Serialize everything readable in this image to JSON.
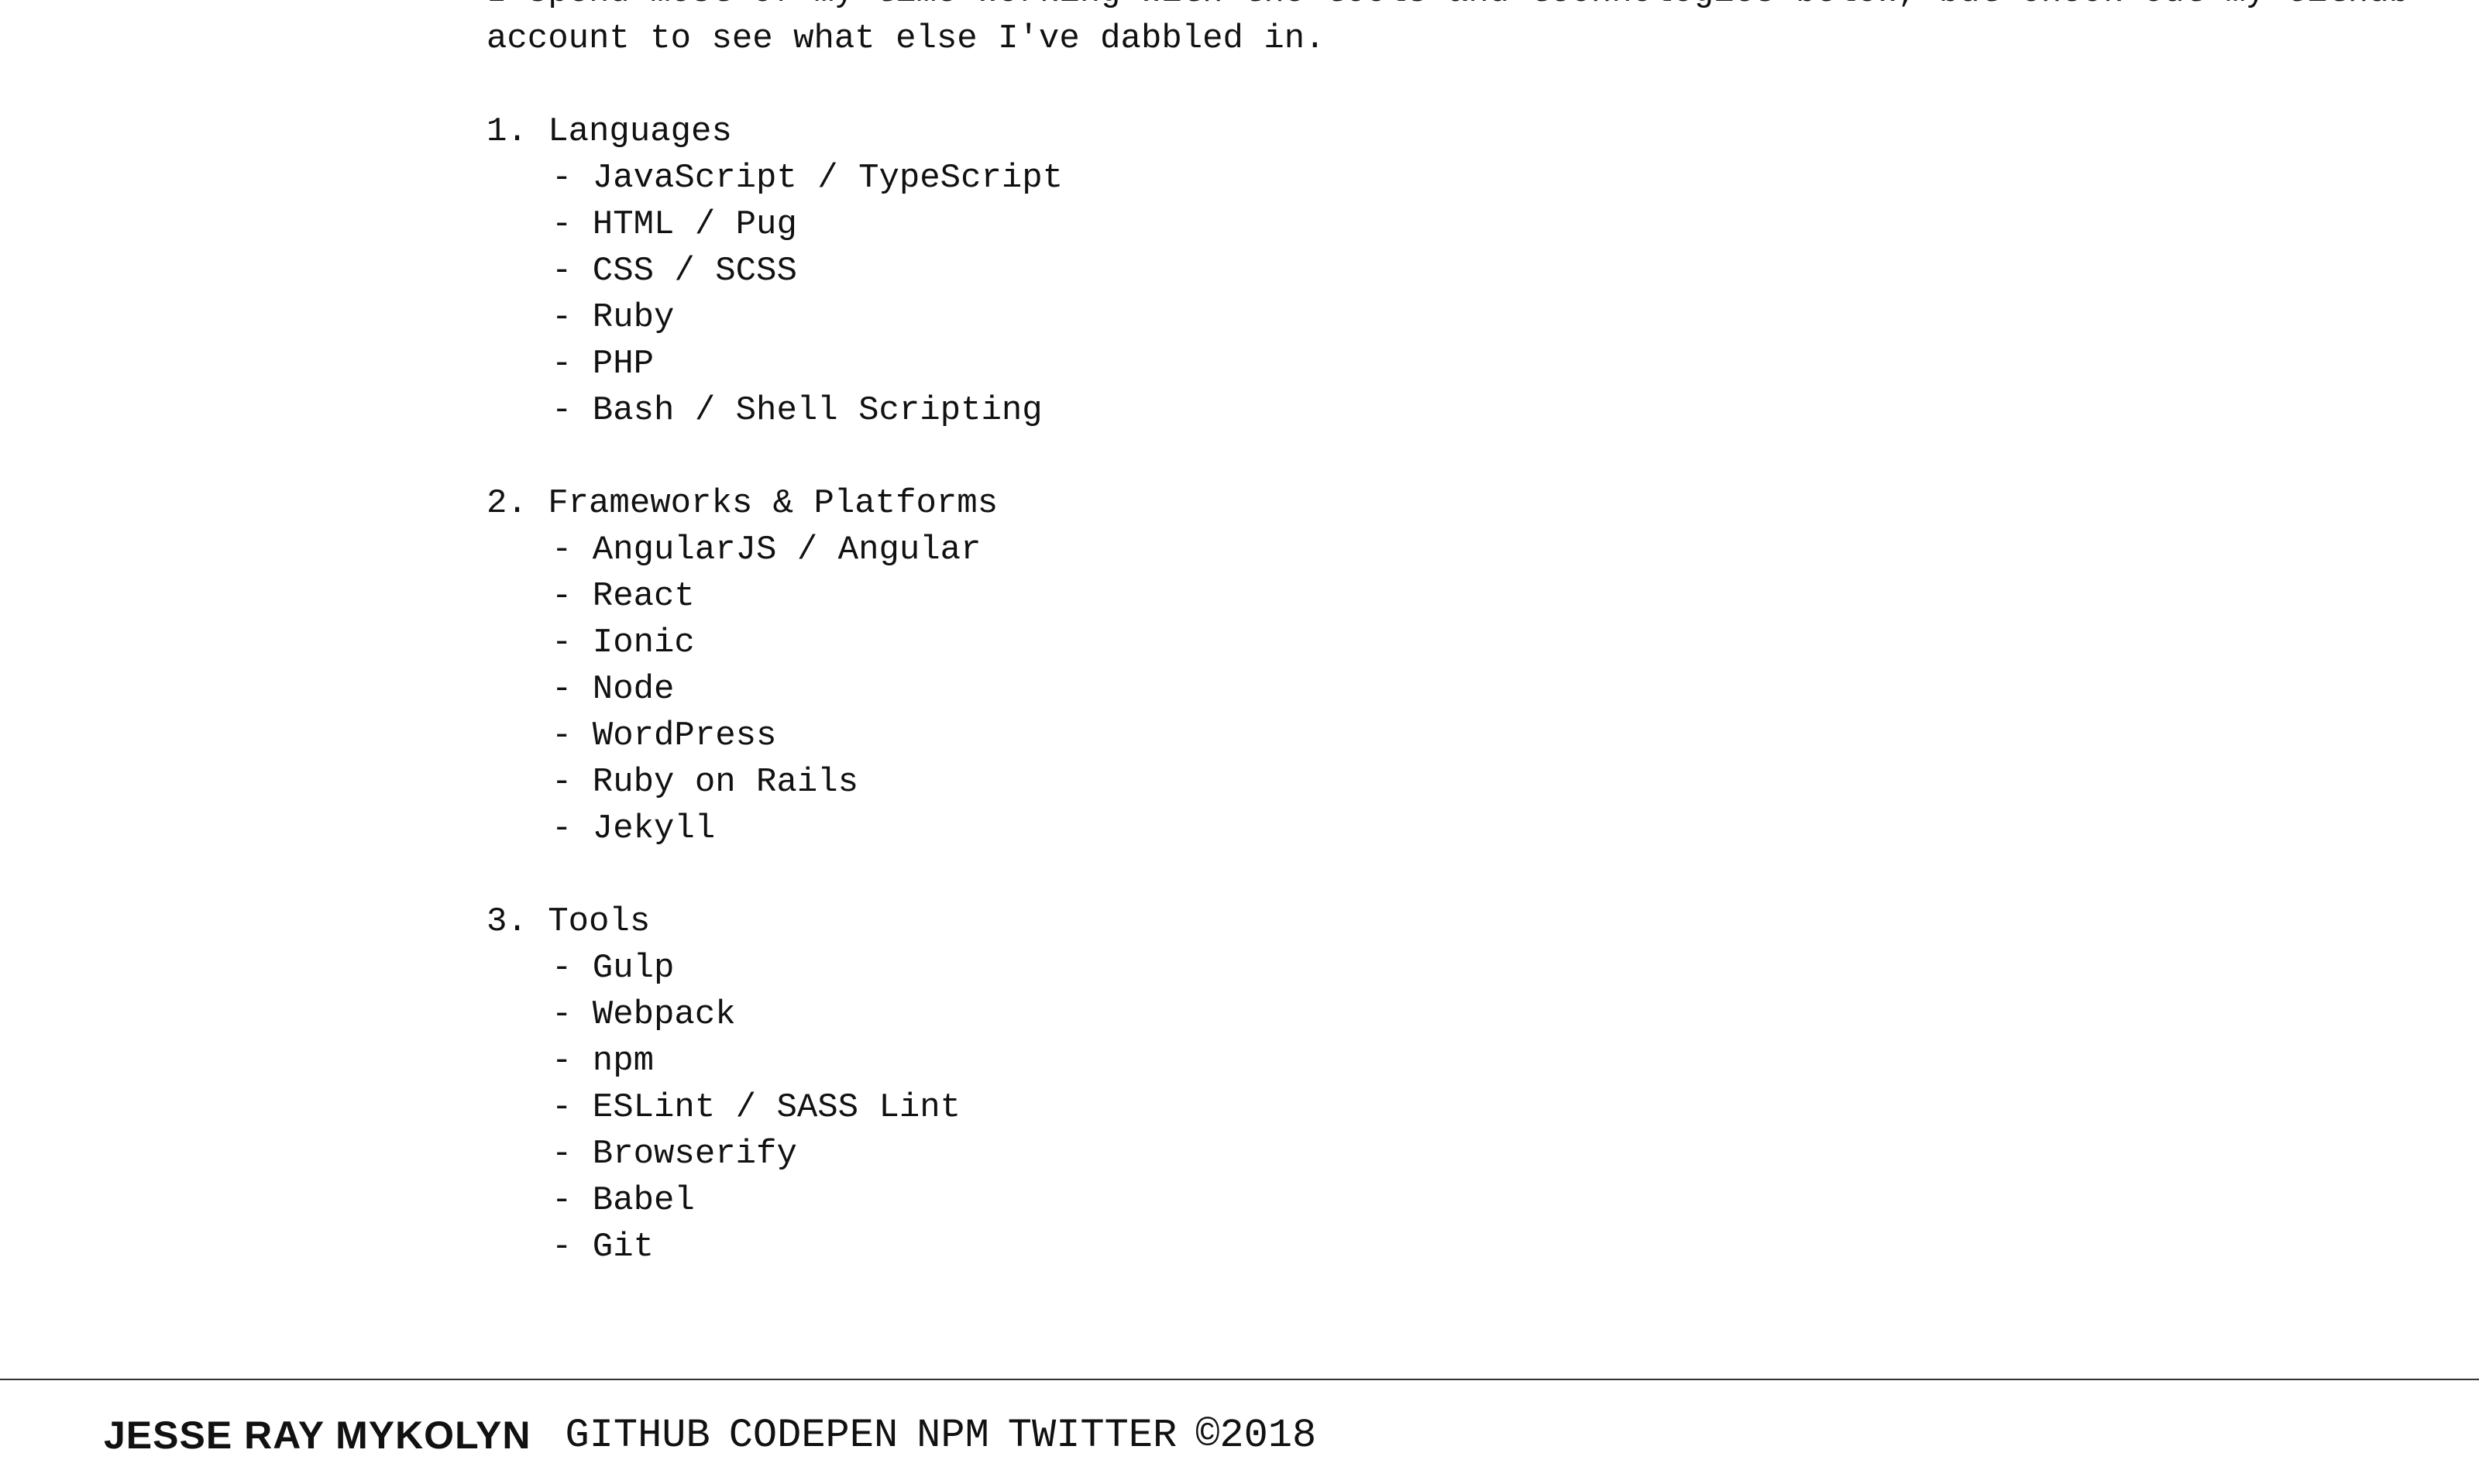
{
  "intro": {
    "line1": "I spend most of my time working with the tools and technologies below, but check out my Github",
    "line2": "account to see what else I've dabbled in."
  },
  "sections": [
    {
      "heading": "1. Languages",
      "items": [
        "- JavaScript / TypeScript",
        "- HTML / Pug",
        "- CSS / SCSS",
        "- Ruby",
        "- PHP",
        "- Bash / Shell Scripting"
      ]
    },
    {
      "heading": "2. Frameworks & Platforms",
      "items": [
        "- AngularJS / Angular",
        "- React",
        "- Ionic",
        "- Node",
        "- WordPress",
        "- Ruby on Rails",
        "- Jekyll"
      ]
    },
    {
      "heading": "3. Tools",
      "items": [
        "- Gulp",
        "- Webpack",
        "- npm",
        "- ESLint / SASS Lint",
        "- Browserify",
        "- Babel",
        "- Git"
      ]
    }
  ],
  "footer": {
    "brand": "JESSE RAY MYKOLYN",
    "links": [
      "GITHUB",
      "CODEPEN",
      "NPM",
      "TWITTER"
    ],
    "copyright": "©2018"
  }
}
